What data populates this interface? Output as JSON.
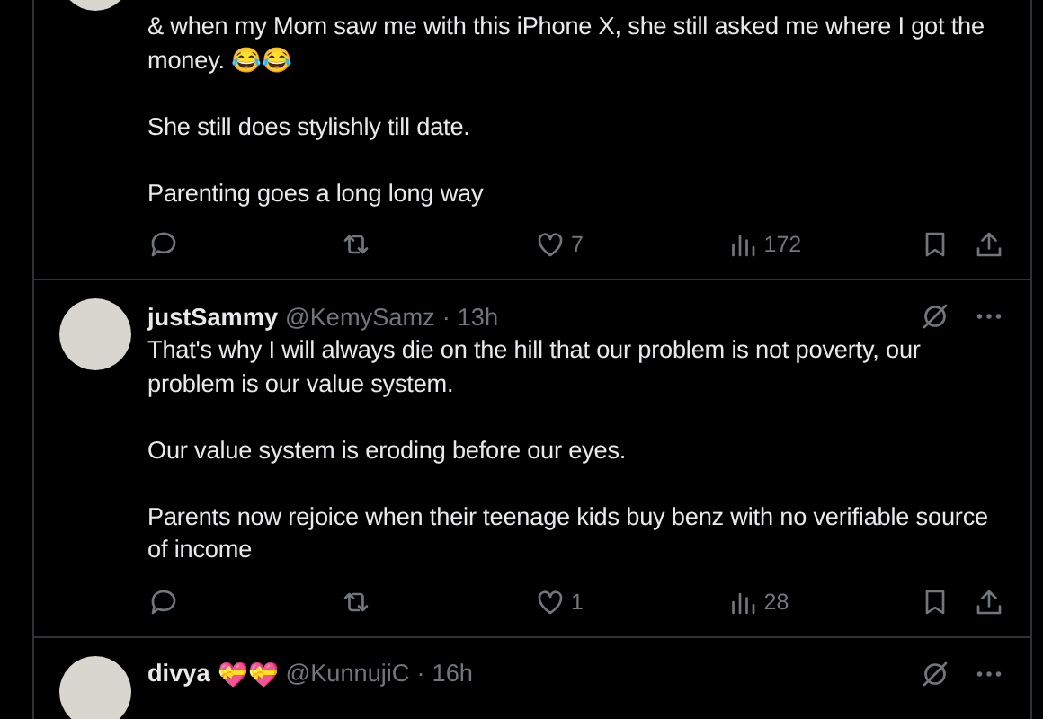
{
  "tweets": [
    {
      "paragraphs": [
        "& when my Mom saw me with this iPhone X, she still asked me where I got the money. 😂😂",
        "She still does stylishly till date.",
        "Parenting goes a long long way"
      ],
      "actions": {
        "likes": "7",
        "views": "172"
      }
    },
    {
      "name": "justSammy",
      "handle": "@KemySamz",
      "separator": "·",
      "time": "13h",
      "paragraphs": [
        "That's why I will always die on the hill that our problem is not poverty, our problem is our value system.",
        "Our value system is eroding before our eyes.",
        "Parents now rejoice when their teenage kids buy benz with no verifiable source of income"
      ],
      "actions": {
        "likes": "1",
        "views": "28"
      }
    },
    {
      "name": "divya",
      "emoji": "💝💝",
      "handle": "@KunnujiC",
      "separator": "·",
      "time": "16h"
    }
  ]
}
